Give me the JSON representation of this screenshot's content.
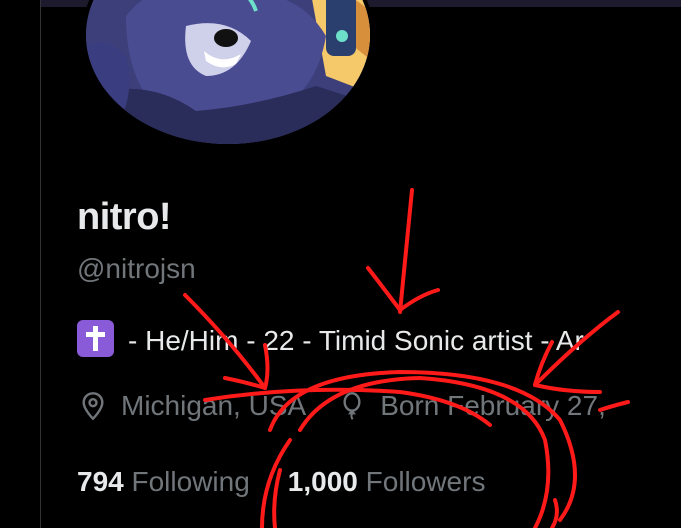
{
  "profile": {
    "display_name": "nitro!",
    "handle": "@nitrojsn",
    "bio_text": "- He/Him - 22 - Timid Sonic artist - Ar",
    "location": "Michigan, USA",
    "birthday": "Born February 27,",
    "following_count": "794",
    "following_label": "Following",
    "followers_count": "1,000",
    "followers_label": "Followers"
  },
  "icons": {
    "bio_emoji": "latin-cross-emoji",
    "location": "location-pin-icon",
    "birthday": "balloon-icon"
  },
  "colors": {
    "background": "#000000",
    "primary_text": "#e7e9ea",
    "secondary_text": "#71767b",
    "annotation": "#ff1a1a",
    "emoji_bg": "#8a5bd8"
  }
}
